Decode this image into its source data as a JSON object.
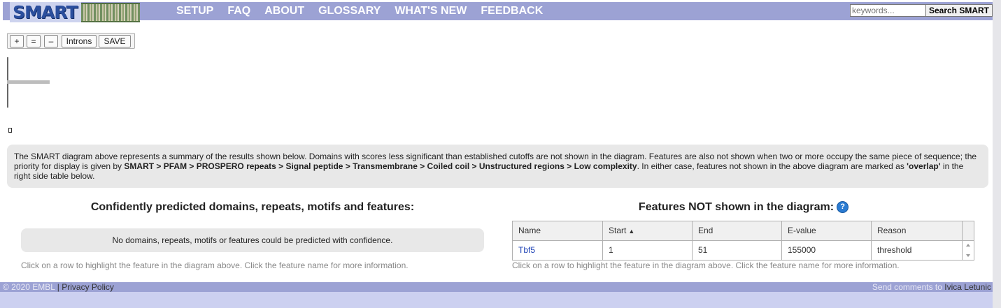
{
  "header": {
    "logo_text": "SMART",
    "nav": [
      "SETUP",
      "FAQ",
      "ABOUT",
      "GLOSSARY",
      "WHAT'S NEW",
      "FEEDBACK"
    ],
    "search_placeholder": "keywords...",
    "search_button": "Search SMART"
  },
  "toolbar": {
    "zoom_in": "+",
    "reset": "=",
    "zoom_out": "–",
    "introns": "Introns",
    "save": "SAVE"
  },
  "info": {
    "text_1": "The SMART diagram above represents a summary of the results shown below. Domains with scores less significant than established cutoffs are not shown in the diagram. Features are also not shown when two or more occupy the same piece of sequence; the priority for display is given by ",
    "priority": "SMART > PFAM > PROSPERO repeats > Signal peptide > Transmembrane > Coiled coil > Unstructured regions > Low complexity",
    "text_2": ". In either case, features not shown in the above diagram are marked as ",
    "overlap": "'overlap'",
    "text_3": " in the right side table below."
  },
  "confident": {
    "title": "Confidently predicted domains, repeats, motifs and features:",
    "empty_message": "No domains, repeats, motifs or features could be predicted with confidence.",
    "note": "Click on a row to highlight the feature in the diagram above. Click the feature name for more information."
  },
  "not_shown": {
    "title": "Features NOT shown in the diagram:",
    "help_icon": "?",
    "columns": [
      "Name",
      "Start",
      "End",
      "E-value",
      "Reason"
    ],
    "sort_indicator": "▲",
    "rows": [
      {
        "name": "Tbf5",
        "start": "1",
        "end": "51",
        "evalue": "155000",
        "reason": "threshold"
      }
    ],
    "note": "Click on a row to highlight the feature in the diagram above. Click the feature name for more information."
  },
  "footer": {
    "copyright": "© 2020 EMBL",
    "separator": "|",
    "privacy": "Privacy Policy",
    "comments_prefix": "Send comments to",
    "contact": "Ivica Letunic"
  }
}
